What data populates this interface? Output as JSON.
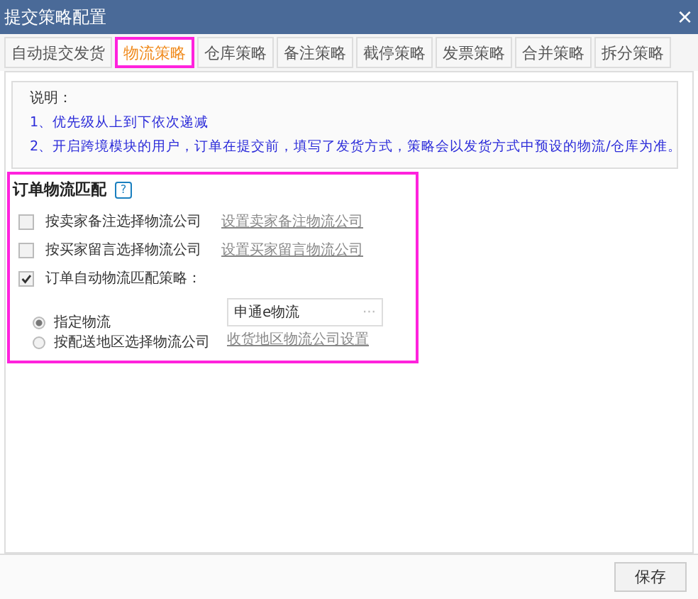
{
  "window": {
    "title": "提交策略配置",
    "close": "×"
  },
  "tabs": [
    {
      "label": "自动提交发货",
      "selected": false
    },
    {
      "label": "物流策略",
      "selected": true
    },
    {
      "label": "仓库策略",
      "selected": false
    },
    {
      "label": "备注策略",
      "selected": false
    },
    {
      "label": "截停策略",
      "selected": false
    },
    {
      "label": "发票策略",
      "selected": false
    },
    {
      "label": "合并策略",
      "selected": false
    },
    {
      "label": "拆分策略",
      "selected": false
    }
  ],
  "notes": {
    "heading": "说明：",
    "items": [
      "1、优先级从上到下依次递减",
      "2、开启跨境模块的用户，订单在提交前，填写了发货方式，策略会以发货方式中预设的物流/仓库为准。"
    ]
  },
  "section": {
    "title": "订单物流匹配",
    "help": "?",
    "options": [
      {
        "label": "按卖家备注选择物流公司",
        "checked": false,
        "link": "设置卖家备注物流公司"
      },
      {
        "label": "按买家留言选择物流公司",
        "checked": false,
        "link": "设置买家留言物流公司"
      },
      {
        "label": "订单自动物流匹配策略：",
        "checked": true
      }
    ],
    "radios": [
      {
        "label": "指定物流",
        "selected": true
      },
      {
        "label": "按配送地区选择物流公司",
        "selected": false
      }
    ],
    "logistics_field": {
      "value": "申通e物流",
      "button": "···"
    },
    "region_link": "收货地区物流公司设置"
  },
  "buttons": [
    "保存"
  ]
}
